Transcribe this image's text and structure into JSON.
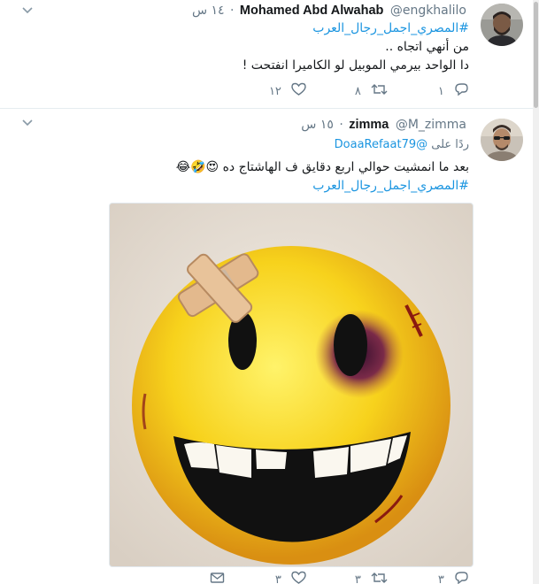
{
  "tweets": [
    {
      "fullname": "Mohamed Abd Alwahab",
      "username": "@engkhalilo",
      "time": "١٤ س",
      "hashtag": "#المصري_اجمل_رجال_العرب",
      "lines": [
        "من أنهي اتجاه ..",
        "دا الواحد بيرمي الموبيل لو  الكاميرا انفتحت !"
      ],
      "reply_count": "١",
      "retweet_count": "٨",
      "like_count": "١٢"
    },
    {
      "fullname": "zimma",
      "username": "@M_zimma",
      "time": "١٥ س",
      "reply_prefix": "ردًا على",
      "reply_to": "@DoaaRefaat79",
      "text": "بعد ما انمشيت حوالي اربع دقايق ف الهاشتاج ده",
      "emojis": "😍🤣😂",
      "hashtag": "#المصري_اجمل_رجال_العرب",
      "reply_count": "٣",
      "retweet_count": "٣",
      "like_count": "٣"
    }
  ],
  "icons": {
    "caret": "chevron-down-icon",
    "reply": "reply-icon",
    "retweet": "retweet-icon",
    "like": "heart-icon",
    "dm": "envelope-icon"
  },
  "colors": {
    "link": "#1b95e0",
    "text": "#14171a",
    "muted": "#657786",
    "border": "#e6ecf0"
  }
}
